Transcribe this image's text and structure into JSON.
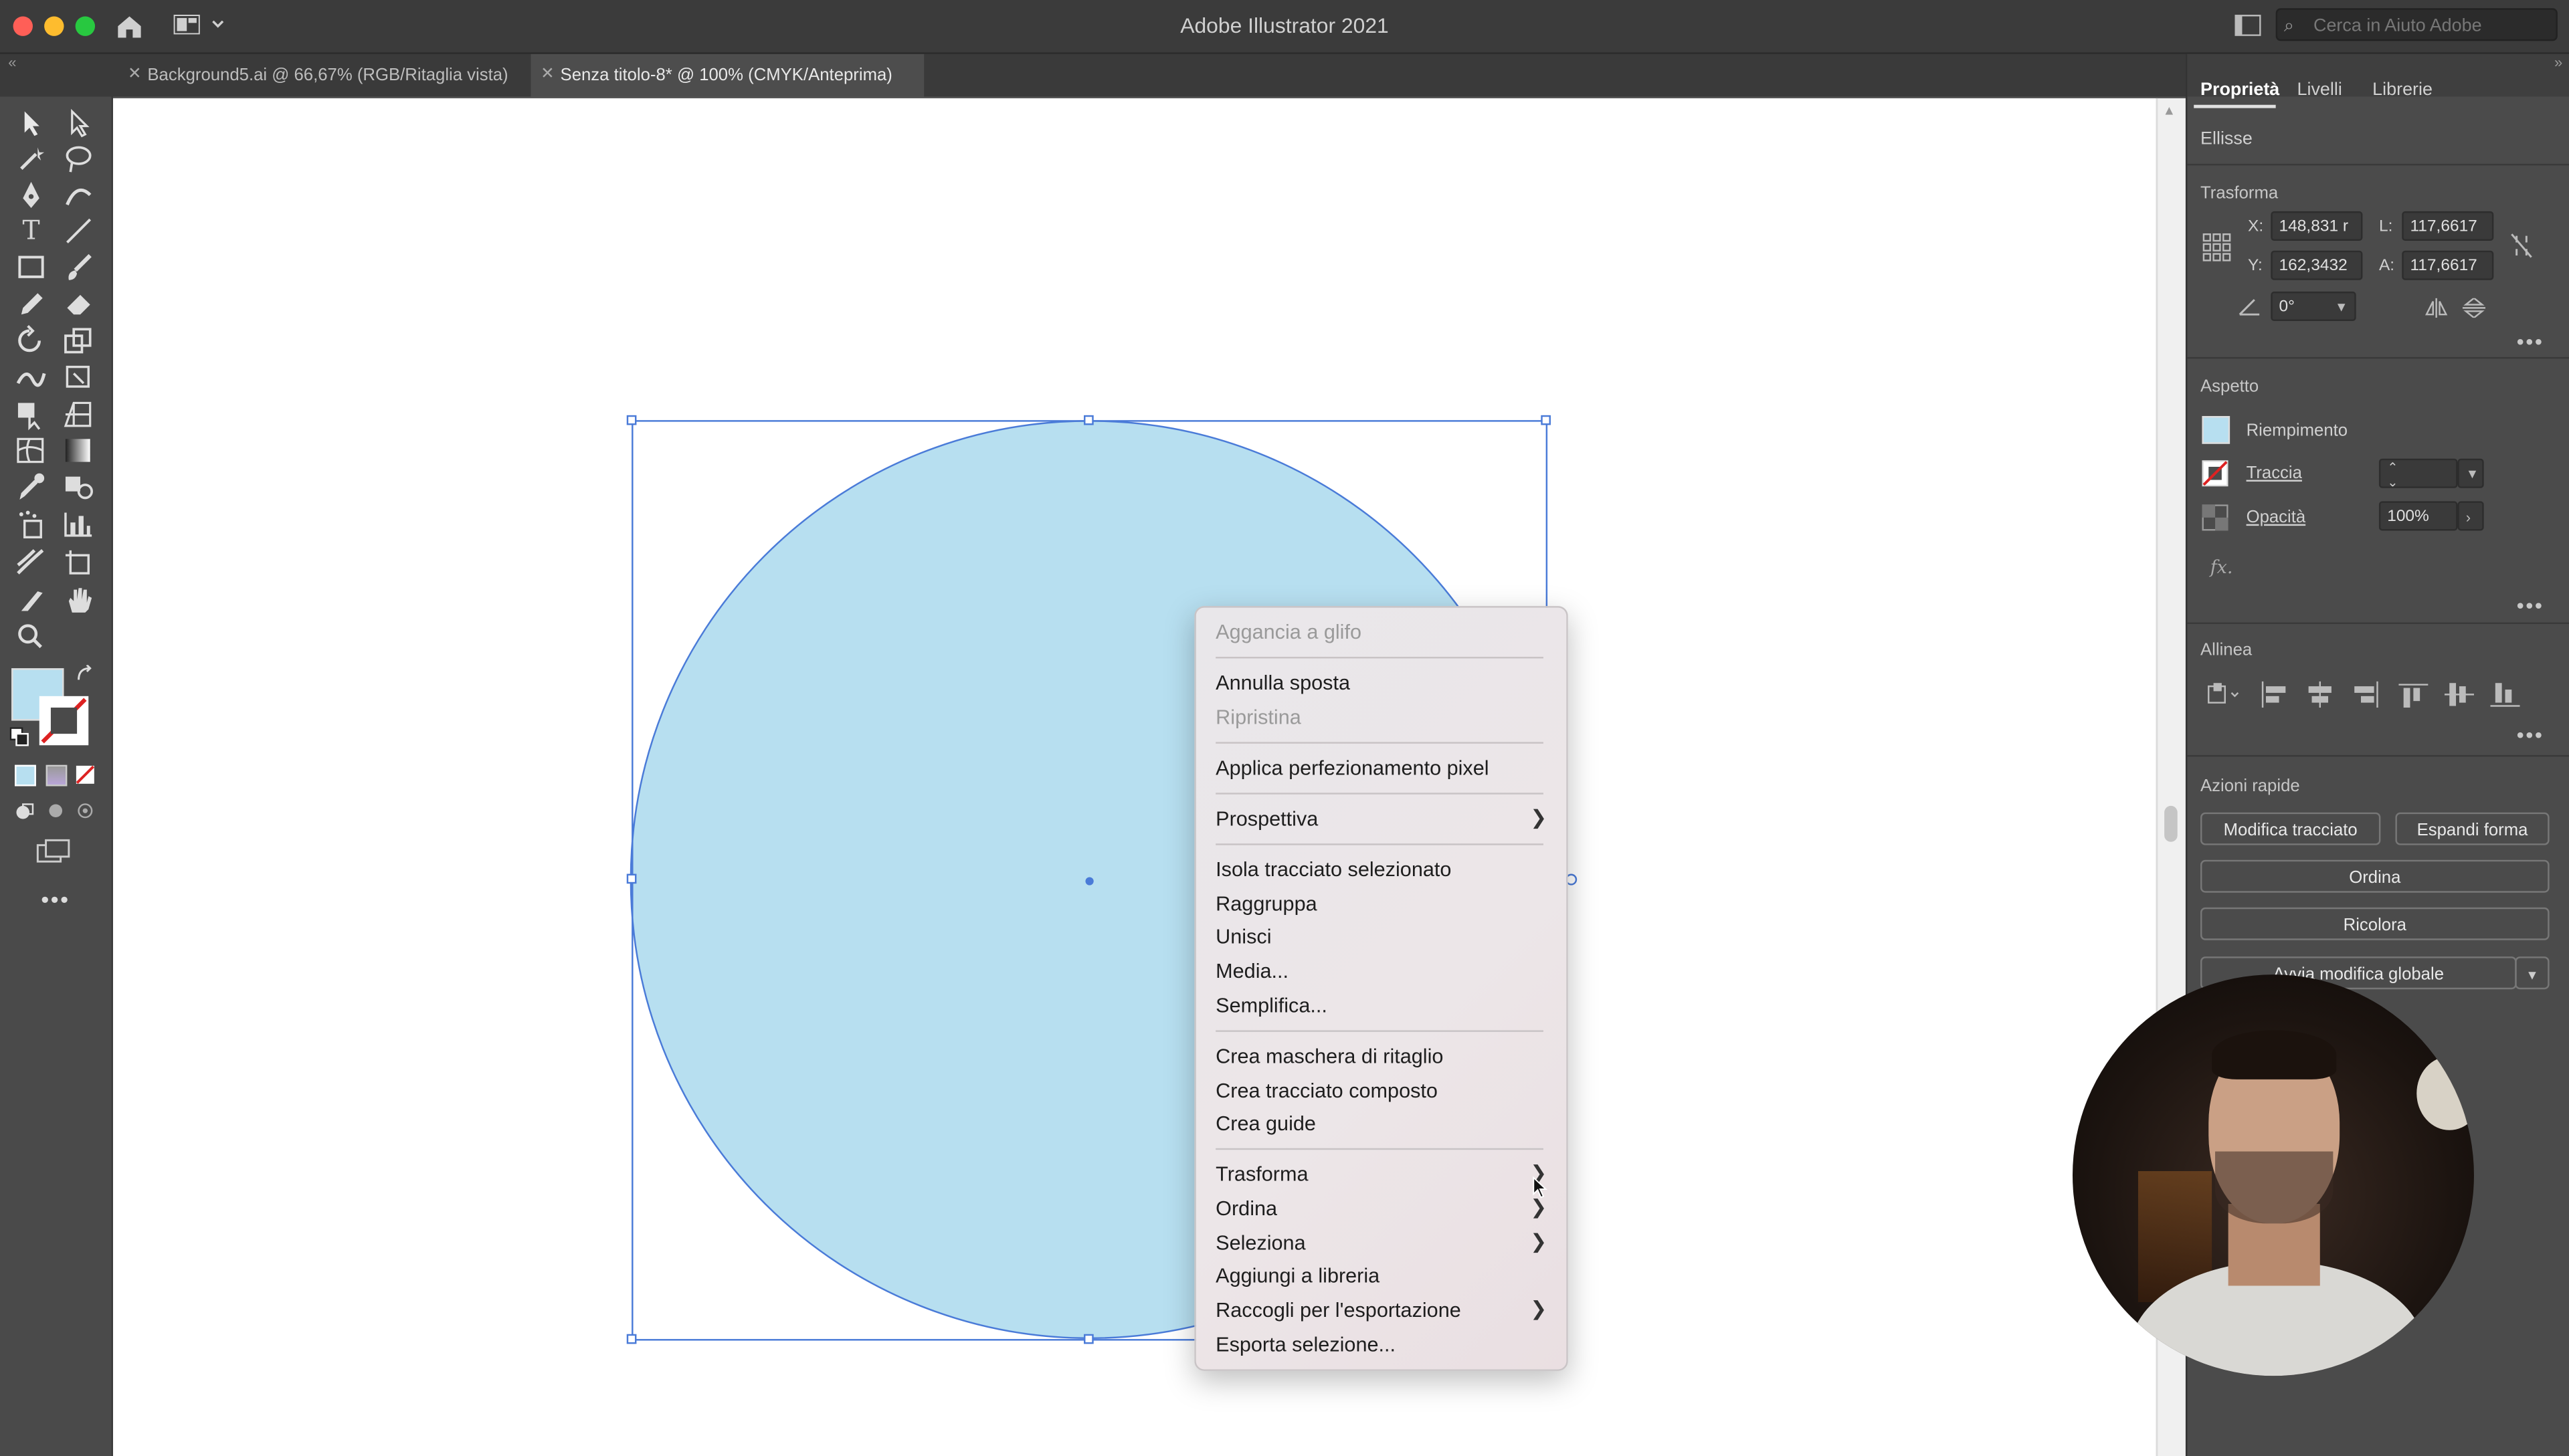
{
  "app": {
    "title": "Adobe Illustrator 2021",
    "search_placeholder": "Cerca in Aiuto Adobe"
  },
  "colors": {
    "fill": "#b7dff0",
    "selection": "#4a7bd8",
    "ui_dark": "#535353"
  },
  "tabs": [
    {
      "label": "Background5.ai @ 66,67% (RGB/Ritaglia vista)",
      "active": false
    },
    {
      "label": "Senza titolo-8* @ 100% (CMYK/Anteprima)",
      "active": true
    }
  ],
  "panel": {
    "tabs": [
      "Proprietà",
      "Livelli",
      "Librerie"
    ],
    "object_type": "Ellisse",
    "transform": {
      "title": "Trasforma",
      "x_label": "X:",
      "x": "148,831 r",
      "y_label": "Y:",
      "y": "162,3432",
      "w_label": "L:",
      "w": "117,6617",
      "h_label": "A:",
      "h": "117,6617",
      "angle": "0°"
    },
    "appearance": {
      "title": "Aspetto",
      "fill_label": "Riempimento",
      "stroke_label": "Traccia",
      "opacity_label": "Opacità",
      "opacity": "100%",
      "fx": "fx."
    },
    "align": {
      "title": "Allinea"
    },
    "quick_actions": {
      "title": "Azioni rapide",
      "edit_path": "Modifica tracciato",
      "expand_shape": "Espandi forma",
      "arrange": "Ordina",
      "recolor": "Ricolora",
      "global_edit": "Avvia modifica globale"
    }
  },
  "context_menu": {
    "items": [
      {
        "label": "Aggancia a glifo",
        "disabled": true
      },
      {
        "label": "Annulla sposta"
      },
      {
        "label": "Ripristina",
        "disabled": true
      },
      {
        "label": "Applica perfezionamento pixel"
      },
      {
        "label": "Prospettiva",
        "submenu": true
      },
      {
        "label": "Isola tracciato selezionato"
      },
      {
        "label": "Raggruppa"
      },
      {
        "label": "Unisci"
      },
      {
        "label": "Media..."
      },
      {
        "label": "Semplifica..."
      },
      {
        "label": "Crea maschera di ritaglio"
      },
      {
        "label": "Crea tracciato composto"
      },
      {
        "label": "Crea guide"
      },
      {
        "label": "Trasforma",
        "submenu": true
      },
      {
        "label": "Ordina",
        "submenu": true
      },
      {
        "label": "Seleziona",
        "submenu": true
      },
      {
        "label": "Aggiungi a libreria"
      },
      {
        "label": "Raccogli per l'esportazione",
        "submenu": true
      },
      {
        "label": "Esporta selezione..."
      }
    ]
  },
  "icons": [
    "home-icon",
    "workspace-icon",
    "selection-tool-icon",
    "direct-selection-tool-icon",
    "magic-wand-icon",
    "lasso-icon",
    "pen-tool-icon",
    "type-tool-icon",
    "line-tool-icon",
    "rectangle-tool-icon",
    "paintbrush-icon",
    "pencil-icon",
    "eraser-icon",
    "rotate-icon",
    "scale-icon",
    "hand-tool-icon",
    "zoom-tool-icon",
    "eyedropper-icon",
    "chart-tool-icon"
  ]
}
